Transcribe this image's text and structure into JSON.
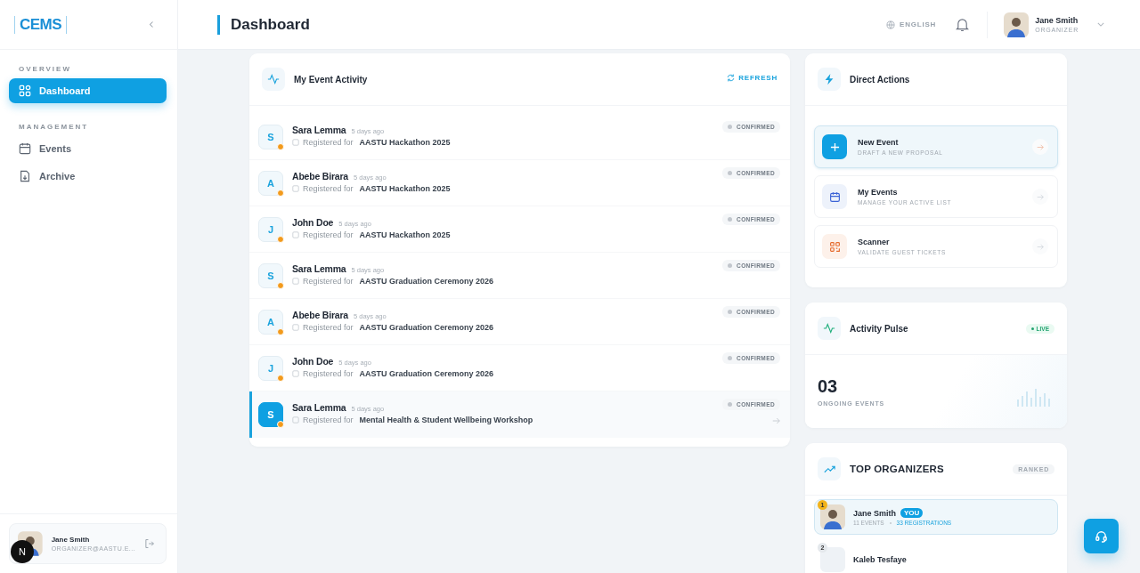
{
  "sidebar": {
    "logo": "CEMS",
    "sections": [
      {
        "title": "OVERVIEW",
        "items": [
          {
            "label": "Dashboard",
            "kind": "grid",
            "selected": true
          }
        ]
      },
      {
        "title": "MANAGEMENT",
        "items": [
          {
            "label": "Events",
            "kind": "calendar",
            "selected": false
          },
          {
            "label": "Archive",
            "kind": "file",
            "selected": false
          }
        ]
      }
    ],
    "user": {
      "name": "Jane Smith",
      "email": "ORGANIZER@AASTU.E..."
    },
    "dev_badge": "N"
  },
  "header": {
    "title": "Dashboard",
    "language": "ENGLISH",
    "user_name": "Jane Smith",
    "user_role": "ORGANIZER"
  },
  "activity": {
    "title": "My Event Activity",
    "refresh": "REFRESH",
    "items": [
      {
        "initial": "S",
        "name": "Sara Lemma",
        "time": "5 days ago",
        "prefix": "Registered for",
        "event": "AASTU Hackathon 2025",
        "status": "CONFIRMED",
        "selected": false
      },
      {
        "initial": "A",
        "name": "Abebe Birara",
        "time": "5 days ago",
        "prefix": "Registered for",
        "event": "AASTU Hackathon 2025",
        "status": "CONFIRMED",
        "selected": false
      },
      {
        "initial": "J",
        "name": "John Doe",
        "time": "5 days ago",
        "prefix": "Registered for",
        "event": "AASTU Hackathon 2025",
        "status": "CONFIRMED",
        "selected": false
      },
      {
        "initial": "S",
        "name": "Sara Lemma",
        "time": "5 days ago",
        "prefix": "Registered for",
        "event": "AASTU Graduation Ceremony 2026",
        "status": "CONFIRMED",
        "selected": false
      },
      {
        "initial": "A",
        "name": "Abebe Birara",
        "time": "5 days ago",
        "prefix": "Registered for",
        "event": "AASTU Graduation Ceremony 2026",
        "status": "CONFIRMED",
        "selected": false
      },
      {
        "initial": "J",
        "name": "John Doe",
        "time": "5 days ago",
        "prefix": "Registered for",
        "event": "AASTU Graduation Ceremony 2026",
        "status": "CONFIRMED",
        "selected": false
      },
      {
        "initial": "S",
        "name": "Sara Lemma",
        "time": "5 days ago",
        "prefix": "Registered for",
        "event": "Mental Health & Student Wellbeing Workshop",
        "status": "CONFIRMED",
        "selected": true
      }
    ]
  },
  "direct_actions": {
    "title": "Direct Actions",
    "items": [
      {
        "kind": "plus",
        "title": "New Event",
        "subtitle": "DRAFT A NEW PROPOSAL",
        "selected": true
      },
      {
        "kind": "calendar",
        "title": "My Events",
        "subtitle": "MANAGE YOUR ACTIVE LIST",
        "selected": false
      },
      {
        "kind": "qr",
        "title": "Scanner",
        "subtitle": "VALIDATE GUEST TICKETS",
        "selected": false
      }
    ]
  },
  "pulse": {
    "title": "Activity Pulse",
    "badge": "LIVE",
    "value": "03",
    "label": "ONGOING EVENTS"
  },
  "organizers": {
    "title": "TOP ORGANIZERS",
    "badge": "RANKED",
    "items": [
      {
        "rank": "1",
        "name": "Jane Smith",
        "tag": "YOU",
        "events": "11 EVENTS",
        "registrations": "33 REGISTRATIONS",
        "selected": true
      },
      {
        "rank": "2",
        "name": "Kaleb Tesfaye",
        "selected": false
      }
    ]
  }
}
